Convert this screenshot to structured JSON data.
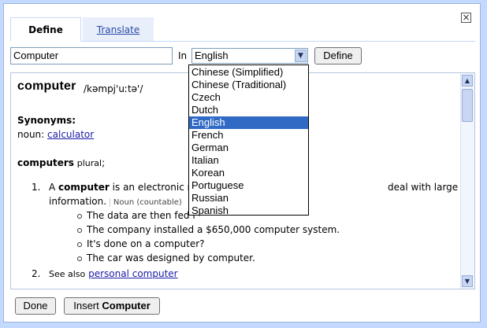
{
  "dialog": {
    "close_symbol": "×"
  },
  "tabs": [
    {
      "label": "Define",
      "active": true
    },
    {
      "label": "Translate",
      "active": false
    }
  ],
  "search": {
    "word": "Computer",
    "in_label": "In",
    "language": "English",
    "define_label": "Define"
  },
  "result": {
    "headword": "computer",
    "pronunciation": "/kəmpj'uːtə'/",
    "synonyms_label": "Synonyms:",
    "synonym_pos": "noun:",
    "synonym": "calculator",
    "word_form": "computers",
    "word_form_note": "plural",
    "word_form_suffix": ";",
    "definitions": [
      {
        "number": "1.",
        "prefix": "A",
        "bold_word": "computer",
        "text_a": "is an electronic m",
        "text_b": "deal with large amounts of",
        "text_c": "information.",
        "grammar": "Noun (countable)",
        "examples": [
          "The data are then fed i",
          "The company installed a $650,000 computer system.",
          "It's done on a computer?",
          "The car was designed by computer."
        ]
      },
      {
        "number": "2.",
        "see_also_label": "See also",
        "see_also_link": "personal computer"
      }
    ]
  },
  "footer": {
    "done_label": "Done",
    "insert_prefix": "Insert",
    "insert_word": "Computer"
  },
  "language_dropdown": {
    "options": [
      "Chinese (Simplified)",
      "Chinese (Traditional)",
      "Czech",
      "Dutch",
      "English",
      "French",
      "German",
      "Italian",
      "Korean",
      "Portuguese",
      "Russian",
      "Spanish"
    ],
    "selected": "English"
  },
  "colors": {
    "accent": "#316ac5",
    "link": "#1a1aa6",
    "frame": "#c3d9ff"
  },
  "icons": {
    "close": "close-icon",
    "dropdown": "chevron-down-icon",
    "scroll_up": "scroll-up-icon",
    "scroll_down": "scroll-down-icon"
  }
}
